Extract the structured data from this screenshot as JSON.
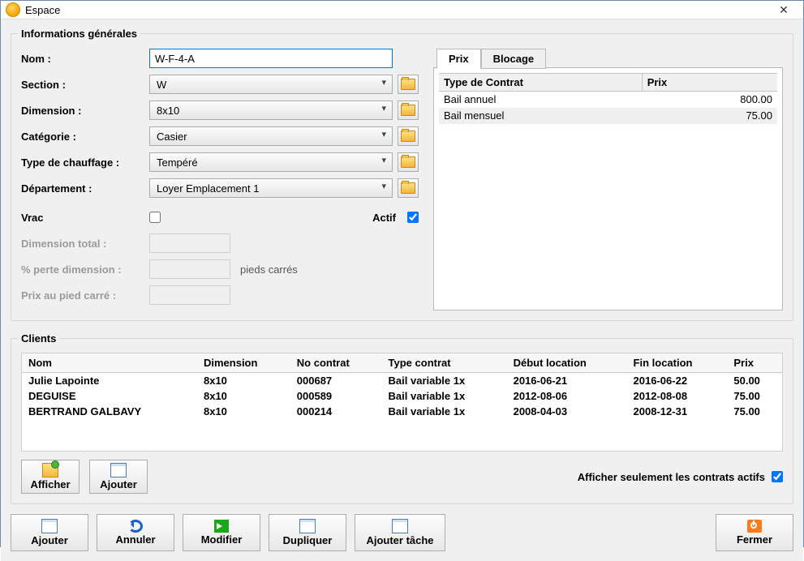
{
  "window": {
    "title": "Espace"
  },
  "group": {
    "title": "Informations générales"
  },
  "labels": {
    "nom": "Nom :",
    "section": "Section :",
    "dimension": "Dimension :",
    "categorie": "Catégorie :",
    "chauffage": "Type de chauffage :",
    "departement": "Département :",
    "vrac": "Vrac",
    "actif": "Actif",
    "dim_total": "Dimension total :",
    "perte": "% perte dimension :",
    "prix_pied": "Prix au pied carré :",
    "unit": "pieds carrés"
  },
  "values": {
    "nom": "W-F-4-A",
    "section": "W",
    "dimension": "8x10",
    "categorie": "Casier",
    "chauffage": "Tempéré",
    "departement": "Loyer Emplacement 1",
    "vrac": false,
    "actif": true
  },
  "tabs": {
    "prix": "Prix",
    "blocage": "Blocage"
  },
  "prix_table": {
    "headers": {
      "type": "Type de Contrat",
      "prix": "Prix"
    },
    "rows": [
      {
        "type": "Bail annuel",
        "prix": "800.00"
      },
      {
        "type": "Bail mensuel",
        "prix": "75.00"
      }
    ]
  },
  "clients": {
    "title": "Clients",
    "headers": {
      "nom": "Nom",
      "dimension": "Dimension",
      "no_contrat": "No contrat",
      "type_contrat": "Type contrat",
      "debut": "Début location",
      "fin": "Fin location",
      "prix": "Prix"
    },
    "rows": [
      {
        "nom": "Julie Lapointe",
        "dimension": "8x10",
        "no_contrat": "000687",
        "type_contrat": "Bail variable 1x",
        "debut": "2016-06-21",
        "fin": "2016-06-22",
        "prix": "50.00"
      },
      {
        "nom": " DEGUISE",
        "dimension": "8x10",
        "no_contrat": "000589",
        "type_contrat": "Bail variable 1x",
        "debut": "2012-08-06",
        "fin": "2012-08-08",
        "prix": "75.00"
      },
      {
        "nom": "BERTRAND GALBAVY",
        "dimension": "8x10",
        "no_contrat": "000214",
        "type_contrat": "Bail variable 1x",
        "debut": "2008-04-03",
        "fin": "2008-12-31",
        "prix": "75.00"
      }
    ],
    "only_active_label": "Afficher seulement les contrats actifs",
    "only_active": true,
    "buttons": {
      "afficher": "Afficher",
      "ajouter": "Ajouter"
    }
  },
  "bottom": {
    "ajouter": "Ajouter",
    "annuler": "Annuler",
    "modifier": "Modifier",
    "dupliquer": "Dupliquer",
    "ajouter_tache": "Ajouter tâche",
    "fermer": "Fermer"
  }
}
